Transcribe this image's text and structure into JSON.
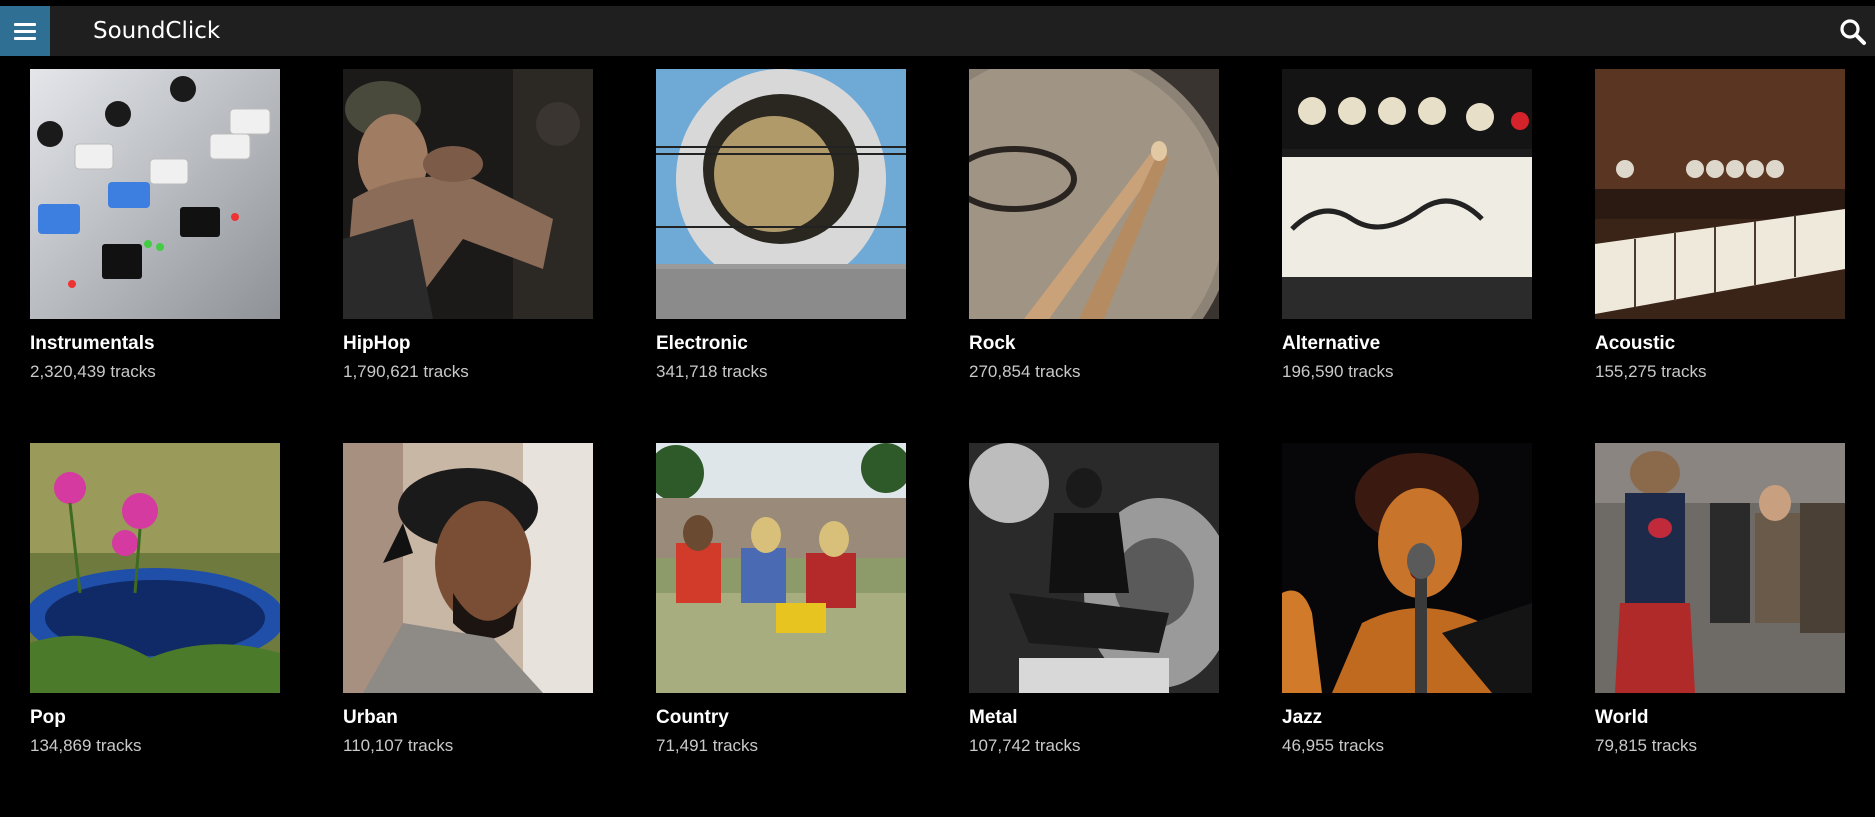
{
  "app": {
    "title": "SoundClick",
    "menu_icon": "hamburger-icon",
    "search_icon": "search-icon"
  },
  "colors": {
    "menu_button_bg": "#2f6f93",
    "topbar_bg": "#1f1f1f",
    "page_bg": "#000000"
  },
  "genres": [
    {
      "name": "Instrumentals",
      "tracks": "2,320,439 tracks"
    },
    {
      "name": "HipHop",
      "tracks": "1,790,621 tracks"
    },
    {
      "name": "Electronic",
      "tracks": "341,718 tracks"
    },
    {
      "name": "Rock",
      "tracks": "270,854 tracks"
    },
    {
      "name": "Alternative",
      "tracks": "196,590 tracks"
    },
    {
      "name": "Acoustic",
      "tracks": "155,275 tracks"
    },
    {
      "name": "Pop",
      "tracks": "134,869 tracks"
    },
    {
      "name": "Urban",
      "tracks": "110,107 tracks"
    },
    {
      "name": "Country",
      "tracks": "71,491 tracks"
    },
    {
      "name": "Metal",
      "tracks": "107,742 tracks"
    },
    {
      "name": "Jazz",
      "tracks": "46,955 tracks"
    },
    {
      "name": "World",
      "tracks": "79,815 tracks"
    }
  ]
}
